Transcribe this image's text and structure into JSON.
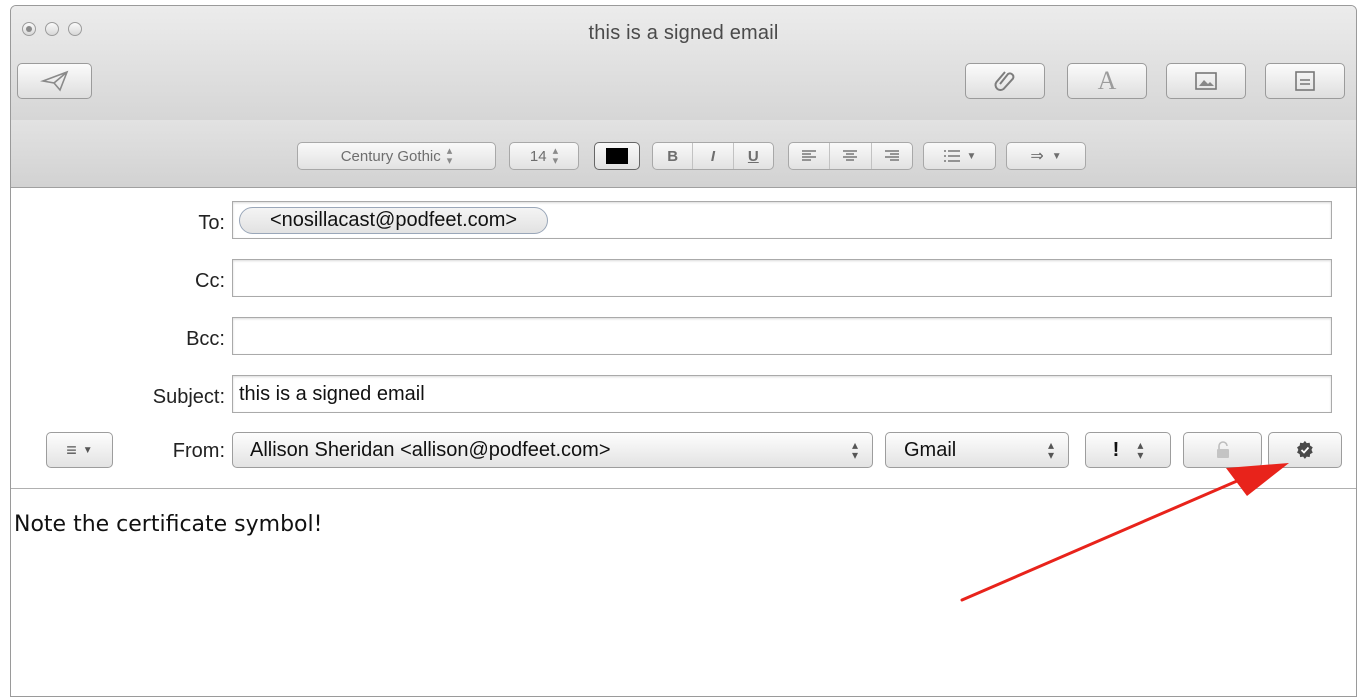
{
  "window": {
    "title": "this is a signed email"
  },
  "toolbar": {
    "send_icon": "send-paper-plane-icon",
    "attach_icon": "paperclip-icon",
    "fonts_label": "A",
    "photo_icon": "photo-browser-icon",
    "stationery_icon": "stationery-icon"
  },
  "format_bar": {
    "font_family": "Century Gothic",
    "font_size": "14",
    "color": "#000000",
    "bold": "B",
    "italic": "I",
    "underline": "U",
    "align_icons": [
      "align-left-icon",
      "align-center-icon",
      "align-right-icon"
    ],
    "list_icon": "list-icon",
    "indent_icon": "indent-arrow-icon"
  },
  "headers": {
    "to_label": "To:",
    "to_recipient": "<nosillacast@podfeet.com>",
    "cc_label": "Cc:",
    "cc_value": "",
    "bcc_label": "Bcc:",
    "bcc_value": "",
    "subject_label": "Subject:",
    "subject_value": "this is a signed email",
    "from_label": "From:",
    "from_value": "Allison Sheridan <allison@podfeet.com>",
    "account_value": "Gmail",
    "priority_value": "!",
    "header_menu_icon": "header-fields-menu-icon",
    "encrypt_icon": "lock-open-icon",
    "sign_icon": "certificate-seal-icon"
  },
  "body": {
    "text": "Note the certificate symbol!"
  },
  "annotation": {
    "arrow_color": "#e8231b"
  }
}
